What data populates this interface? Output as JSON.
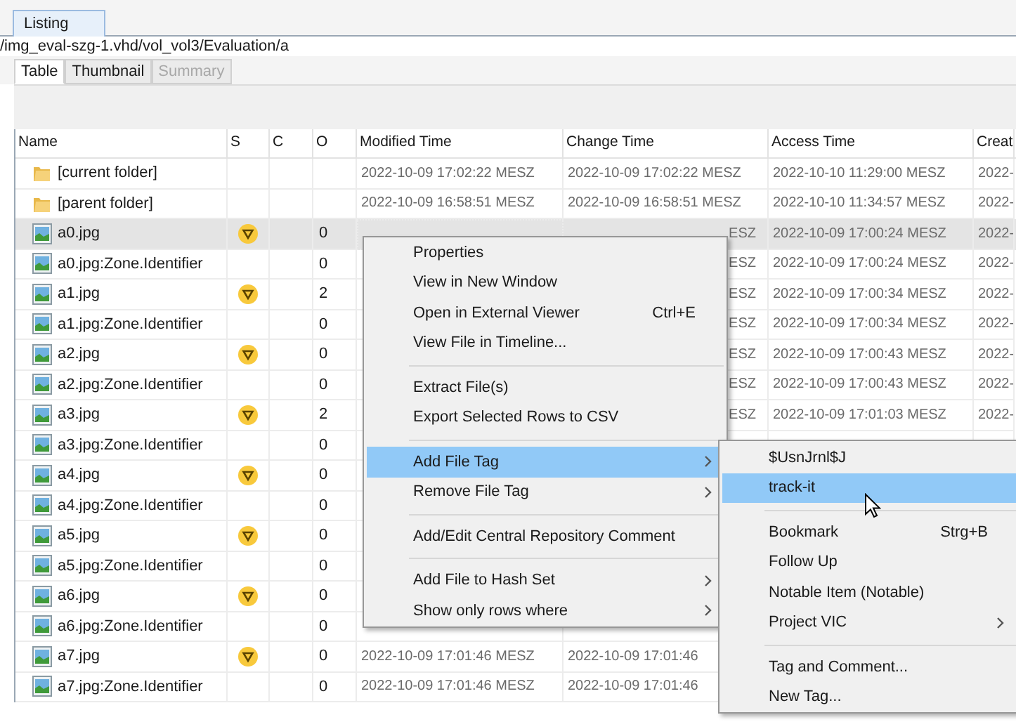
{
  "window_tab": {
    "label": "Listing",
    "selected": true
  },
  "path": "/img_eval-szg-1.vhd/vol_vol3/Evaluation/a",
  "view_tabs": [
    {
      "label": "Table",
      "selected": true,
      "disabled": false
    },
    {
      "label": "Thumbnail",
      "selected": false,
      "disabled": false
    },
    {
      "label": "Summary",
      "selected": false,
      "disabled": true
    }
  ],
  "table": {
    "columns": [
      "Name",
      "S",
      "C",
      "O",
      "Modified Time",
      "Change Time",
      "Access Time",
      "Creat"
    ],
    "rows": [
      {
        "kind": "folder",
        "name": "[current folder]",
        "tagged": false,
        "o": "",
        "modified": "2022-10-09 17:02:22 MESZ",
        "change": "2022-10-09 17:02:22 MESZ",
        "access": "2022-10-10 11:29:00 MESZ",
        "created": "2022-",
        "selected": false
      },
      {
        "kind": "folder",
        "name": "[parent folder]",
        "tagged": false,
        "o": "",
        "modified": "2022-10-09 16:58:51 MESZ",
        "change": "2022-10-09 16:58:51 MESZ",
        "access": "2022-10-10 11:34:57 MESZ",
        "created": "2022-",
        "selected": false
      },
      {
        "kind": "image",
        "name": "a0.jpg",
        "tagged": true,
        "o": "0",
        "modified": "",
        "change": "ESZ",
        "access": "2022-10-09 17:00:24 MESZ",
        "created": "2022-",
        "selected": true
      },
      {
        "kind": "image",
        "name": "a0.jpg:Zone.Identifier",
        "tagged": false,
        "o": "0",
        "modified": "",
        "change": "ESZ",
        "access": "2022-10-09 17:00:24 MESZ",
        "created": "2022-",
        "selected": false
      },
      {
        "kind": "image",
        "name": "a1.jpg",
        "tagged": true,
        "o": "2",
        "modified": "",
        "change": "ESZ",
        "access": "2022-10-09 17:00:34 MESZ",
        "created": "2022-",
        "selected": false
      },
      {
        "kind": "image",
        "name": "a1.jpg:Zone.Identifier",
        "tagged": false,
        "o": "0",
        "modified": "",
        "change": "ESZ",
        "access": "2022-10-09 17:00:34 MESZ",
        "created": "2022-",
        "selected": false
      },
      {
        "kind": "image",
        "name": "a2.jpg",
        "tagged": true,
        "o": "0",
        "modified": "",
        "change": "ESZ",
        "access": "2022-10-09 17:00:43 MESZ",
        "created": "2022-",
        "selected": false
      },
      {
        "kind": "image",
        "name": "a2.jpg:Zone.Identifier",
        "tagged": false,
        "o": "0",
        "modified": "",
        "change": "ESZ",
        "access": "2022-10-09 17:00:43 MESZ",
        "created": "2022-",
        "selected": false
      },
      {
        "kind": "image",
        "name": "a3.jpg",
        "tagged": true,
        "o": "2",
        "modified": "",
        "change": "ESZ",
        "access": "2022-10-09 17:01:03 MESZ",
        "created": "2022-",
        "selected": false
      },
      {
        "kind": "image",
        "name": "a3.jpg:Zone.Identifier",
        "tagged": false,
        "o": "0",
        "modified": "",
        "change": "",
        "access": "",
        "created": "",
        "selected": false
      },
      {
        "kind": "image",
        "name": "a4.jpg",
        "tagged": true,
        "o": "0",
        "modified": "",
        "change": "",
        "access": "",
        "created": "",
        "selected": false
      },
      {
        "kind": "image",
        "name": "a4.jpg:Zone.Identifier",
        "tagged": false,
        "o": "0",
        "modified": "",
        "change": "",
        "access": "",
        "created": "",
        "selected": false
      },
      {
        "kind": "image",
        "name": "a5.jpg",
        "tagged": true,
        "o": "0",
        "modified": "",
        "change": "",
        "access": "",
        "created": "",
        "selected": false
      },
      {
        "kind": "image",
        "name": "a5.jpg:Zone.Identifier",
        "tagged": false,
        "o": "0",
        "modified": "",
        "change": "",
        "access": "",
        "created": "",
        "selected": false
      },
      {
        "kind": "image",
        "name": "a6.jpg",
        "tagged": true,
        "o": "0",
        "modified": "",
        "change": "",
        "access": "",
        "created": "",
        "selected": false
      },
      {
        "kind": "image",
        "name": "a6.jpg:Zone.Identifier",
        "tagged": false,
        "o": "0",
        "modified": "",
        "change": "",
        "access": "",
        "created": "",
        "selected": false
      },
      {
        "kind": "image",
        "name": "a7.jpg",
        "tagged": true,
        "o": "0",
        "modified": "2022-10-09 17:01:46 MESZ",
        "change": "2022-10-09 17:01:46",
        "access": "",
        "created": "",
        "selected": false
      },
      {
        "kind": "image",
        "name": "a7.jpg:Zone.Identifier",
        "tagged": false,
        "o": "0",
        "modified": "2022-10-09 17:01:46 MESZ",
        "change": "2022-10-09 17:01:46",
        "access": "",
        "created": "",
        "selected": false
      }
    ]
  },
  "context_menu": [
    {
      "kind": "item",
      "label": "Properties",
      "highlighted": false,
      "submenu": false
    },
    {
      "kind": "item",
      "label": "View in New Window",
      "highlighted": false,
      "submenu": false
    },
    {
      "kind": "item",
      "label": "Open in External Viewer",
      "shortcut": "Ctrl+E",
      "highlighted": false,
      "submenu": false
    },
    {
      "kind": "item",
      "label": "View File in Timeline...",
      "highlighted": false,
      "submenu": false
    },
    {
      "kind": "separator"
    },
    {
      "kind": "item",
      "label": "Extract File(s)",
      "highlighted": false,
      "submenu": false
    },
    {
      "kind": "item",
      "label": "Export Selected Rows to CSV",
      "highlighted": false,
      "submenu": false
    },
    {
      "kind": "separator"
    },
    {
      "kind": "item",
      "label": "Add File Tag",
      "highlighted": true,
      "submenu": true
    },
    {
      "kind": "item",
      "label": "Remove File Tag",
      "highlighted": false,
      "submenu": true
    },
    {
      "kind": "separator"
    },
    {
      "kind": "item",
      "label": "Add/Edit Central Repository Comment",
      "highlighted": false,
      "submenu": false
    },
    {
      "kind": "separator"
    },
    {
      "kind": "item",
      "label": "Add File to Hash Set",
      "highlighted": false,
      "submenu": true
    },
    {
      "kind": "item",
      "label": "Show only rows where",
      "highlighted": false,
      "submenu": true
    }
  ],
  "submenu": [
    {
      "kind": "item",
      "label": "$UsnJrnl$J",
      "highlighted": false,
      "submenu": false
    },
    {
      "kind": "item",
      "label": "track-it",
      "highlighted": true,
      "submenu": false
    },
    {
      "kind": "separator"
    },
    {
      "kind": "item",
      "label": "Bookmark",
      "shortcut": "Strg+B",
      "highlighted": false,
      "submenu": false
    },
    {
      "kind": "item",
      "label": "Follow Up",
      "highlighted": false,
      "submenu": false
    },
    {
      "kind": "item",
      "label": "Notable Item (Notable)",
      "highlighted": false,
      "submenu": false
    },
    {
      "kind": "item",
      "label": "Project VIC",
      "highlighted": false,
      "submenu": true
    },
    {
      "kind": "separator"
    },
    {
      "kind": "item",
      "label": "Tag and Comment...",
      "highlighted": false,
      "submenu": false
    },
    {
      "kind": "item",
      "label": "New Tag...",
      "highlighted": false,
      "submenu": false
    }
  ]
}
